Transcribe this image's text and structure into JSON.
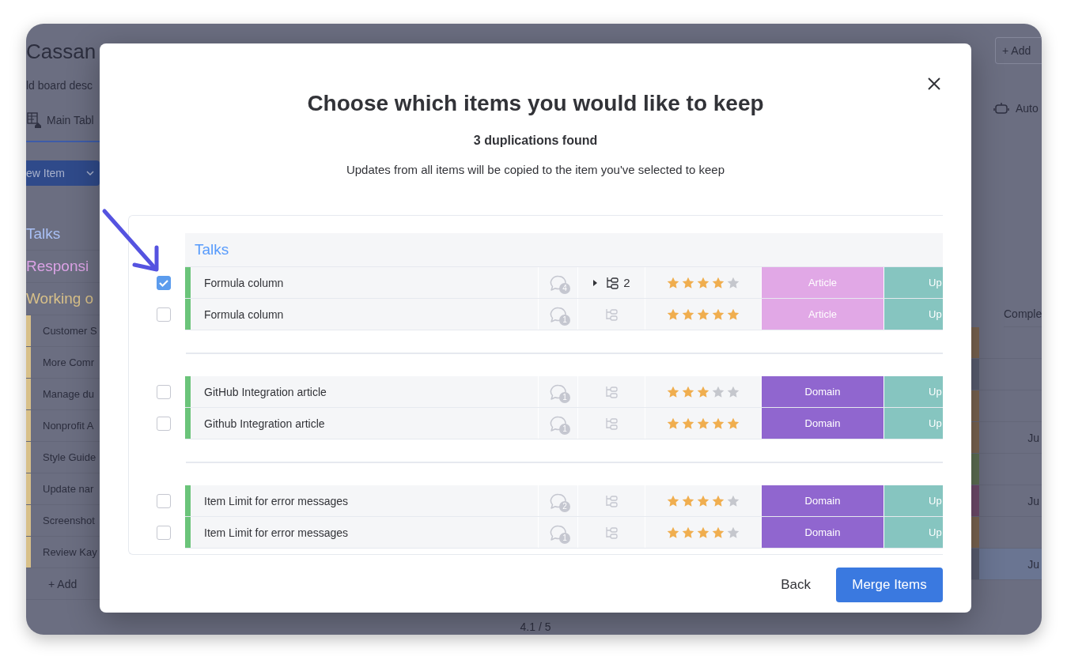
{
  "board": {
    "title": "Cassan",
    "description": "ld board desc",
    "tab": "Main Tabl",
    "new_item_button": "ew Item",
    "groups": [
      {
        "name": "Talks",
        "color": "#a9c0f5"
      },
      {
        "name": "Responsi",
        "color": "#dca3e6"
      },
      {
        "name": "Working o",
        "color": "#d8c089"
      }
    ],
    "add_button": "+ Add",
    "automate": "Auto",
    "column_header": "Comple",
    "rows": [
      {
        "name": "Customer S",
        "color": "#7a6450",
        "date": ""
      },
      {
        "name": "More Comr",
        "color": "#595d70",
        "date": ""
      },
      {
        "name": "Manage du",
        "color": "#7a6450",
        "date": ""
      },
      {
        "name": "Nonprofit A",
        "color": "#7a6450",
        "date": "Ju"
      },
      {
        "name": "Style Guide",
        "color": "#5d6e52",
        "date": ""
      },
      {
        "name": "Update nar",
        "color": "#6e4a6a",
        "date": "Ju"
      },
      {
        "name": "Screenshot",
        "color": "#7a6450",
        "date": ""
      },
      {
        "name": "Review Kay",
        "color": "#595d70",
        "date": "Ju",
        "selected": true
      }
    ],
    "add_row": "+ Add",
    "pager": "4.1 / 5"
  },
  "modal": {
    "title": "Choose which items you would like to keep",
    "count": "3 duplications found",
    "note": "Updates from all items will be copied to the item you've selected to keep",
    "groups": [
      {
        "title": "Talks",
        "items": [
          {
            "selected": true,
            "name": "Formula column",
            "comments": "4",
            "subitems": "2",
            "stars": 4,
            "tag": "Article",
            "color": "#e1a8e6",
            "column_6": "Up"
          },
          {
            "selected": false,
            "name": "Formula column",
            "comments": "1",
            "stars": 5,
            "tag": "Article",
            "color": "#e1a8e6",
            "column_6": "Up"
          }
        ]
      },
      {
        "items": [
          {
            "selected": false,
            "name": "GitHub Integration article",
            "comments": "1",
            "stars": 3,
            "tag": "Domain",
            "color": "#9066cf",
            "column_6": "Up"
          },
          {
            "selected": false,
            "name": "Github Integration article",
            "comments": "1",
            "stars": 5,
            "tag": "Domain",
            "color": "#9066cf",
            "column_6": "Up"
          }
        ]
      },
      {
        "items": [
          {
            "selected": false,
            "name": "Item Limit for error messages",
            "comments": "2",
            "stars": 4,
            "tag": "Domain",
            "color": "#9066cf",
            "column_6": "Up"
          },
          {
            "selected": false,
            "name": "Item Limit for error messages",
            "comments": "1",
            "stars": 4,
            "tag": "Domain",
            "color": "#9066cf",
            "column_6": "Up"
          }
        ]
      }
    ],
    "buttons": [
      {
        "label": "Back",
        "kind": "secondary"
      },
      {
        "label": "Merge Items",
        "kind": "primary"
      }
    ]
  }
}
